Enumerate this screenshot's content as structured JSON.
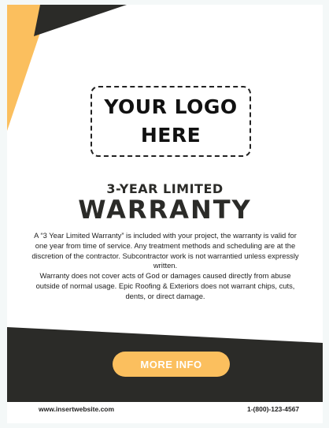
{
  "logo": {
    "line1": "YOUR LOGO",
    "line2": "HERE"
  },
  "heading": {
    "subtitle": "3-YEAR LIMITED",
    "title": "WARRANTY"
  },
  "body": {
    "paragraph1": "A “3 Year Limited Warranty” is included with your project, the warranty is valid for one year from time of service. Any treatment methods and scheduling are at the discretion of the contractor. Subcontractor work is not warrantied unless expressly written.",
    "paragraph2": "Warranty does not cover acts of God or damages caused directly from abuse outside of normal usage. Epic Roofing & Exteriors does not warrant chips, cuts, dents, or direct damage."
  },
  "cta": {
    "label": "MORE INFO"
  },
  "footer": {
    "website": "www.insertwebsite.com",
    "phone": "1-(800)-123-4567"
  },
  "colors": {
    "accent_yellow": "#fbbf5e",
    "dark": "#2b2b28",
    "background": "#ffffff"
  }
}
